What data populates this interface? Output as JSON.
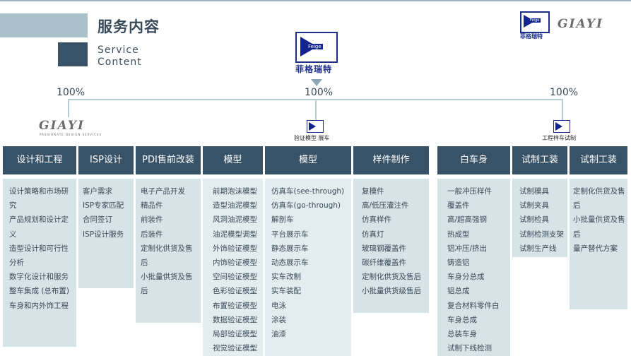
{
  "header": {
    "title": "服务内容",
    "subtitle_line1": "Service",
    "subtitle_line2": "Content"
  },
  "brand": {
    "feige_word": "Feige",
    "feige_cn": "菲格瑞特",
    "giayi_word": "GIAYI",
    "giayi_tagline": "PASSIONATE DESIGN SERVICES"
  },
  "timeline": {
    "left_pct": "100%",
    "center_pct": "100%",
    "right_pct": "100%",
    "center_label": "验证模型 展车",
    "right_label": "工程样车试制"
  },
  "columns": [
    {
      "header": "设计和工程",
      "items": [
        "设计策略和市场研究",
        "产品规划和设计定义",
        "造型设计和可行性分析",
        "数字化设计和服务",
        "整车集成 (总布置)",
        "车身和内外饰工程"
      ]
    },
    {
      "header": "ISP设计",
      "items": [
        "客户需求",
        "ISP专家匹配",
        "合同签订",
        "ISP设计服务"
      ]
    },
    {
      "header": "PDI售前改装",
      "items": [
        "电子产品开发",
        "精品件",
        "前装件",
        "后装件",
        "定制化供货及售后",
        "小批量供货及售后"
      ]
    },
    {
      "header": "模型",
      "items": [
        "前期泡沫模型",
        "造型油泥模型",
        "风洞油泥模型",
        "油泥模型调型",
        "外饰验证模型",
        "内饰验证模型",
        "空间验证模型",
        "色彩验证模型",
        "布置验证模型",
        "数据验证模型",
        "局部验证模型",
        "视觉验证模型"
      ]
    },
    {
      "header": "模型",
      "items": [
        "仿真车(see-through)",
        "仿真车(go-through)",
        "解剖车",
        "平台展示车",
        "静态展示车",
        "动态展示车",
        "实车改制",
        "实车装配",
        "电泳",
        "涂装",
        "油漆"
      ]
    },
    {
      "header": "样件制作",
      "items": [
        "复模件",
        "高/低压灌注件",
        "仿真样件",
        "仿真灯",
        "玻璃钢覆盖件",
        "碳纤维覆盖件",
        "定制化供货及售后",
        "小批量供货级售后"
      ]
    },
    {
      "header": "白车身",
      "items": [
        "一般冲压样件",
        "覆盖件",
        "高/超高强钢",
        "热成型",
        "铝冲压/挤出",
        "铸造铝",
        "车身分总成",
        "铝总成",
        "复合材料零件白",
        "车身总成",
        "总装车身",
        "试制下线检测"
      ]
    },
    {
      "header": "试制工装",
      "items": [
        "试制模具",
        "试制夹具",
        "试制检具",
        "试制检测支架",
        "试制生产线"
      ]
    },
    {
      "header": "试制工装",
      "items": [
        "定制化供货及售后",
        "小批量供货及售后",
        "量产替代方案"
      ]
    }
  ]
}
